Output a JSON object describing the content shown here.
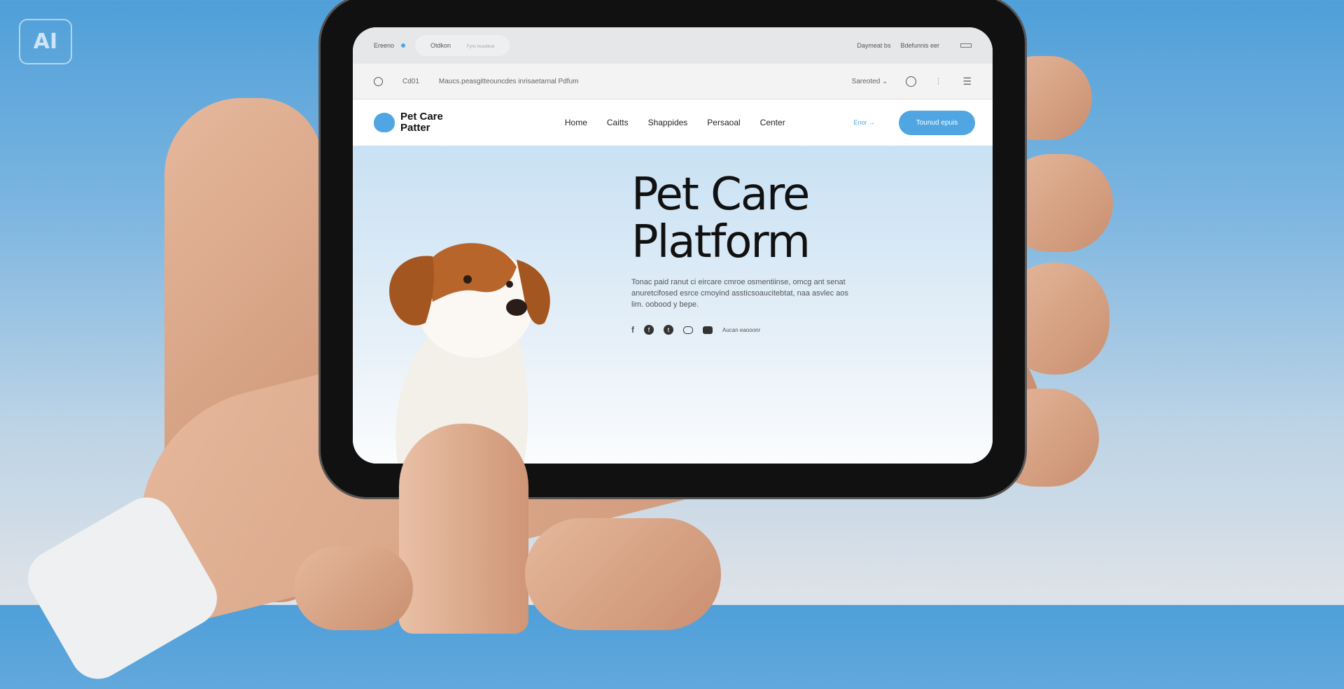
{
  "badge": "AI",
  "topbar": {
    "left": [
      "Ereeno",
      "Otdkon"
    ],
    "tab_hint": "Fyrts headdeal",
    "right": [
      "Daymeat bs",
      "Bdefunnis eer"
    ]
  },
  "urlbar": {
    "tab": "Cd01",
    "url": "Maucs.peasgitteouncdes inrisaetarnal Pdfum",
    "dropdown": "Sareoted"
  },
  "nav": {
    "logo_line1": "Pet Care",
    "logo_line2": "Patter",
    "links": [
      "Home",
      "Caitts",
      "Shappides",
      "Persaoal",
      "Center"
    ],
    "signin": "Enor",
    "cta": "Tounud epuis",
    "accent": "#4fa6e3"
  },
  "hero": {
    "title_line1": "Pet Care",
    "title_line2": "Platform",
    "paragraph": "Tonac paid ranut ci eircare cmroe osmentiinse, omcg ant senat anuretcifosed esrce cmoyind assticsoaucitebtat, naa asvlec aos lim. oobood y bepe.",
    "social_label": "Aucan eaooonr"
  }
}
